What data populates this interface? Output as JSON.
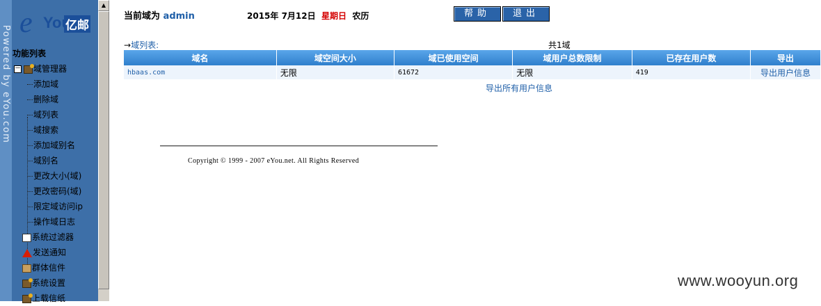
{
  "sidebar": {
    "powered_by": "Powered by eYou.com",
    "logo": {
      "e": "e",
      "you": "You",
      "yi": "亿邮"
    },
    "menu_title": "功能列表",
    "toggle": "－",
    "domain_manager": "域管理器",
    "domain_items": [
      "添加域",
      "删除域",
      "域列表",
      "域搜索",
      "添加域别名",
      "域别名",
      "更改大小(域)",
      "更改密码(域)",
      "限定域访问ip",
      "操作域日志"
    ],
    "top_items": [
      "系统过滤器",
      "发送通知",
      "群体信件",
      "系统设置",
      "上载信纸"
    ]
  },
  "header": {
    "current_domain_prefix": "当前域为",
    "user": "admin",
    "date": "2015年 7月12日",
    "weekday": "星期日",
    "calendar": "农历",
    "help": "帮助",
    "logout": "退出"
  },
  "domain_list": {
    "link_label": "域列表:",
    "arrow": "→",
    "count": "共1域",
    "columns": [
      "域名",
      "域空间大小",
      "域已使用空间",
      "域用户总数限制",
      "已存在用户数",
      "导出"
    ],
    "rows": [
      {
        "domain": "hbaas.com",
        "size": "无限",
        "used": "61672",
        "user_limit": "无限",
        "users": "419",
        "export": "导出用户信息"
      }
    ],
    "export_all": "导出所有用户信息"
  },
  "footer": {
    "copyright": "Copyright © 1999 - 2007 eYou.net. All Rights Reserved"
  },
  "watermark": "www.wooyun.org",
  "colors": {
    "sidebar_bg": "#3d6fa8",
    "header_accent": "#1f5fa8",
    "weekday": "#d40000",
    "table_header": "#3f8fd8",
    "table_row": "#edf4fc"
  }
}
